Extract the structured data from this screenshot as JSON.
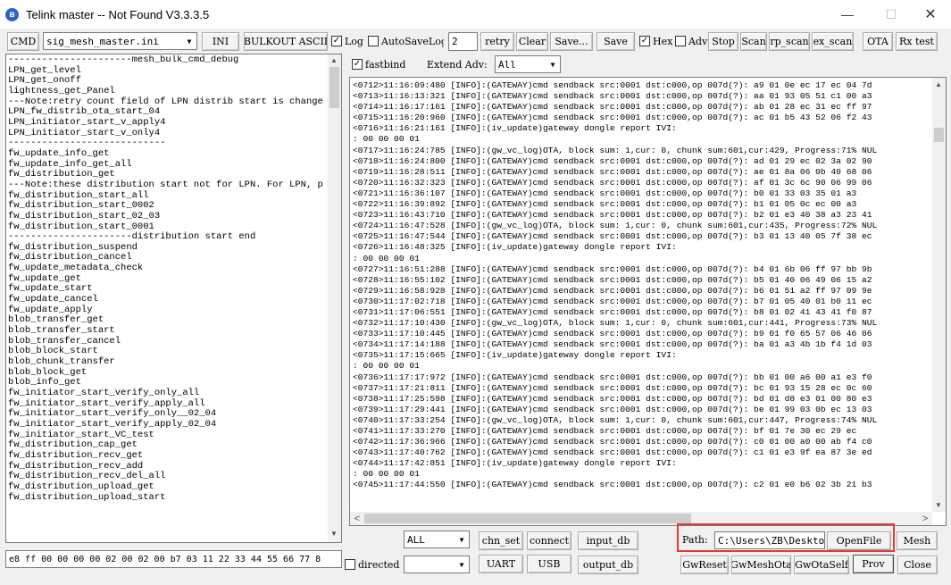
{
  "window": {
    "title": "Telink master -- Not Found   V3.3.3.5",
    "minimize": "—",
    "maximize": "☐",
    "close": "✕"
  },
  "toolbar": {
    "cmd": "CMD",
    "ini_file": "sig_mesh_master.ini",
    "ini": "INI",
    "bulkout": "BULKOUT ASCII",
    "log": "Log",
    "log_checked": "✓",
    "autosave": "AutoSaveLog",
    "autosave_value": "2",
    "retry": "retry",
    "clear": "Clear",
    "save_as": "Save...",
    "save": "Save",
    "hex": "Hex",
    "hex_checked": "✓",
    "adv": "Adv",
    "stop": "Stop",
    "scan": "Scan",
    "rp_scan": "rp_scan",
    "ex_scan": "ex_scan",
    "ota": "OTA",
    "rx_test": "Rx test"
  },
  "filter": {
    "fastbind": "fastbind",
    "fastbind_checked": "✓",
    "extend_adv": "Extend Adv:",
    "extend_adv_value": "All"
  },
  "commands": [
    "----------------------mesh_bulk_cmd_debug",
    "LPN_get_level",
    "LPN_get_onoff",
    "lightness_get_Panel",
    "---Note:retry count field of LPN distrib start is change",
    "LPN_fw_distrib_ota_start_04",
    "LPN_initiator_start_v_apply4",
    "LPN_initiator_start_v_only4",
    "----------------------------",
    "fw_update_info_get",
    "fw_update_info_get_all",
    "fw_distribution_get",
    "---Note:these distribution start not for LPN. For LPN, p",
    "fw_distribution_start_all",
    "fw_distribution_start_0002",
    "fw_distribution_start_02_03",
    "fw_distribution_start_0001",
    "----------------------distribution start end",
    "fw_distribution_suspend",
    "fw_distribution_cancel",
    "fw_update_metadata_check",
    "fw_update_get",
    "fw_update_start",
    "fw_update_cancel",
    "fw_update_apply",
    "blob_transfer_get",
    "blob_transfer_start",
    "blob_transfer_cancel",
    "blob_block_start",
    "blob_chunk_transfer",
    "blob_block_get",
    "blob_info_get",
    "fw_initiator_start_verify_only_all",
    "fw_initiator_start_verify_apply_all",
    "fw_initiator_start_verify_only__02_04",
    "fw_initiator_start_verify_apply_02_04",
    "fw_initiator_start_VC_test",
    "fw_distribution_cap_get",
    "fw_distribution_recv_get",
    "fw_distribution_recv_add",
    "fw_distribution_recv_del_all",
    "fw_distribution_upload_get",
    "fw_distribution_upload_start"
  ],
  "log_lines": [
    "<0712>11:16:09:480 [INFO]:(GATEWAY)cmd sendback src:0001 dst:c000,op 007d(?): a9 01 0e ec 17 ec 04 7d",
    "<0713>11:16:13:321 [INFO]:(GATEWAY)cmd sendback src:0001 dst:c000,op 007d(?): aa 01 93 05 51 c1 00 a3",
    "<0714>11:16:17:161 [INFO]:(GATEWAY)cmd sendback src:0001 dst:c000,op 007d(?): ab 01 28 ec 31 ec ff 97",
    "<0715>11:16:20:960 [INFO]:(GATEWAY)cmd sendback src:0001 dst:c000,op 007d(?): ac 01 b5 43 52 06 f2 43",
    "<0716>11:16:21:161 [INFO]:(iv_update)gateway dongle report IVI:",
    ": 00 00 00 01",
    "<0717>11:16:24:785 [INFO]:(gw_vc_log)OTA, block sum: 1,cur: 0, chunk sum:601,cur:429, Progress:71% NUL",
    "<0718>11:16:24:800 [INFO]:(GATEWAY)cmd sendback src:0001 dst:c000,op 007d(?): ad 01 29 ec 02 3a 02 90",
    "<0719>11:16:28:511 [INFO]:(GATEWAY)cmd sendback src:0001 dst:c000,op 007d(?): ae 01 8a 06 0b 40 68 06",
    "<0720>11:16:32:323 [INFO]:(GATEWAY)cmd sendback src:0001 dst:c000,op 007d(?): af 01 3c 6c 90 06 99 06",
    "<0721>11:16:36:107 [INFO]:(GATEWAY)cmd sendback src:0001 dst:c000,op 007d(?): b0 01 33 03 35 01 a3",
    "<0722>11:16:39:892 [INFO]:(GATEWAY)cmd sendback src:0001 dst:c000,op 007d(?): b1 01 05 0c ec 00 a3",
    "<0723>11:16:43:710 [INFO]:(GATEWAY)cmd sendback src:0001 dst:c000,op 007d(?): b2 01 e3 40 38 a3 23 41",
    "<0724>11:16:47:528 [INFO]:(gw_vc_log)OTA, block sum: 1,cur: 0, chunk sum:601,cur:435, Progress:72% NUL",
    "<0725>11:16:47:544 [INFO]:(GATEWAY)cmd sendback src:0001 dst:c000,op 007d(?): b3 01 13 40 05 7f 38 ec",
    "<0726>11:16:48:325 [INFO]:(iv_update)gateway dongle report IVI:",
    ": 00 00 00 01",
    "<0727>11:16:51:288 [INFO]:(GATEWAY)cmd sendback src:0001 dst:c000,op 007d(?): b4 01 6b 06 ff 97 bb 9b",
    "<0728>11:16:55:102 [INFO]:(GATEWAY)cmd sendback src:0001 dst:c000,op 007d(?): b5 01 40 06 49 06 15 a2",
    "<0729>11:16:58:928 [INFO]:(GATEWAY)cmd sendback src:0001 dst:c000,op 007d(?): b6 01 51 a2 ff 97 09 9e",
    "<0730>11:17:02:718 [INFO]:(GATEWAY)cmd sendback src:0001 dst:c000,op 007d(?): b7 01 05 40 01 b0 11 ec",
    "<0731>11:17:06:551 [INFO]:(GATEWAY)cmd sendback src:0001 dst:c000,op 007d(?): b8 01 02 41 43 41 f0 87",
    "<0732>11:17:10:430 [INFO]:(gw_vc_log)OTA, block sum: 1,cur: 0, chunk sum:601,cur:441, Progress:73% NUL",
    "<0733>11:17:10:445 [INFO]:(GATEWAY)cmd sendback src:0001 dst:c000,op 007d(?): b9 01 f0 65 57 06 46 06",
    "<0734>11:17:14:188 [INFO]:(GATEWAY)cmd sendback src:0001 dst:c000,op 007d(?): ba 01 a3 4b 1b f4 1d 03",
    "<0735>11:17:15:665 [INFO]:(iv_update)gateway dongle report IVI:",
    ": 00 00 00 01",
    "<0736>11:17:17:972 [INFO]:(GATEWAY)cmd sendback src:0001 dst:c000,op 007d(?): bb 01 00 a6 00 a1 e3 f0",
    "<0737>11:17:21:811 [INFO]:(GATEWAY)cmd sendback src:0001 dst:c000,op 007d(?): bc 01 93 15 28 ec 0c 60",
    "<0738>11:17:25:598 [INFO]:(GATEWAY)cmd sendback src:0001 dst:c000,op 007d(?): bd 01 d8 e3 01 00 80 e3",
    "<0739>11:17:29:441 [INFO]:(GATEWAY)cmd sendback src:0001 dst:c000,op 007d(?): be 01 99 03 0b ec 13 03",
    "<0740>11:17:33:254 [INFO]:(gw_vc_log)OTA, block sum: 1,cur: 0, chunk sum:601,cur:447, Progress:74% NUL",
    "<0741>11:17:33:270 [INFO]:(GATEWAY)cmd sendback src:0001 dst:c000,op 007d(?): bf 01 7e 30 ec 29 ec",
    "<0742>11:17:36:966 [INFO]:(GATEWAY)cmd sendback src:0001 dst:c000,op 007d(?): c0 01 00 a0 00 ab f4 c0",
    "<0743>11:17:40:762 [INFO]:(GATEWAY)cmd sendback src:0001 dst:c000,op 007d(?): c1 01 e3 9f ea 87 3e ed",
    "<0744>11:17:42:851 [INFO]:(iv_update)gateway dongle report IVI:",
    ": 00 00 00 01",
    "<0745>11:17:44:550 [INFO]:(GATEWAY)cmd sendback src:0001 dst:c000,op 007d(?): c2 01 e0 b6 02 3b 21 b3"
  ],
  "bottom": {
    "hex_input": "e8 ff 00 00 00 00 02 00 02 00 b7 03 11 22 33 44 55 66 77 8",
    "filter_value": "ALL",
    "chn_set": "chn_set",
    "connect": "connect",
    "input_db": "input_db",
    "path_label": "Path:",
    "path_value": "C:\\Users\\ZB\\Desktop",
    "open_file": "OpenFile",
    "mesh": "Mesh",
    "directed": "directed",
    "uart": "UART",
    "usb": "USB",
    "output_db": "output_db",
    "gw_reset": "GwReset",
    "gw_mesh_ota": "GwMeshOta",
    "gw_ota_self": "GwOtaSelf",
    "prov": "Prov",
    "close": "Close"
  },
  "icons": {
    "app": "bluetooth-icon",
    "dropdown": "▼",
    "scroll_up": "▲",
    "scroll_down": "▼",
    "scroll_left": "<",
    "scroll_right": ">"
  },
  "colors": {
    "highlight": "#e53935",
    "app_icon": "#2a63c7"
  }
}
